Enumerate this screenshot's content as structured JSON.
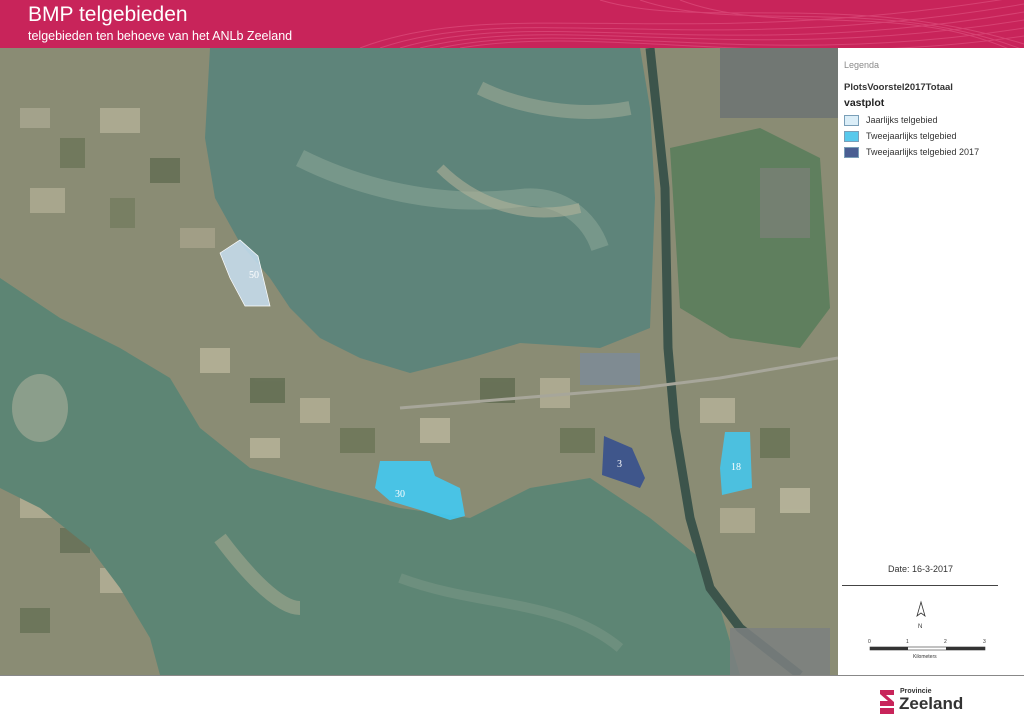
{
  "header": {
    "title": "BMP telgebieden",
    "subtitle": "telgebieden ten behoeve van het ANLb Zeeland",
    "accent_color": "#c8245a"
  },
  "map": {
    "area_labels": [
      "50",
      "30",
      "3",
      "18"
    ],
    "colors": {
      "water": "#58806f",
      "farmland": "#8a8c74",
      "jaarlijks": "#c8dff2",
      "tweejaarlijks": "#41c9f2",
      "tweejaarlijks_2017": "#36508e"
    }
  },
  "legend": {
    "heading": "Legenda",
    "layer_title": "PlotsVoorstel2017Totaal",
    "field_title": "vastplot",
    "items": [
      {
        "label": "Jaarlijks telgebied",
        "color": "#dbeef8"
      },
      {
        "label": "Tweejaarlijks telgebied",
        "color": "#58c9ec"
      },
      {
        "label": "Tweejaarlijks telgebied 2017",
        "color": "#4a5e92"
      }
    ],
    "date": "Date: 16-3-2017",
    "north_label": "N",
    "scale_ticks": [
      "0",
      "1",
      "2",
      "3"
    ],
    "scale_unit": "Kilometers"
  },
  "footer": {
    "logo_small": "Provincie",
    "logo_main": "Zeeland"
  }
}
